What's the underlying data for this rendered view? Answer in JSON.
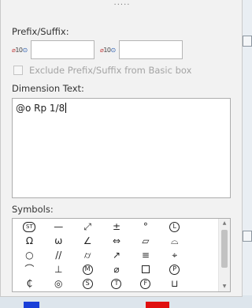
{
  "grip": "·····",
  "prefix_suffix": {
    "label": "Prefix/Suffix:",
    "prefix_icon": "dimension-text-icon",
    "suffix_icon": "dimension-text-icon",
    "prefix_value": "",
    "suffix_value": ""
  },
  "exclude_checkbox": {
    "label": "Exclude Prefix/Suffix from Basic box",
    "checked": false,
    "enabled": false
  },
  "dimension_text": {
    "label": "Dimension Text:",
    "value": "@o Rp 1/8"
  },
  "symbols": {
    "label": "Symbols:",
    "rows": [
      [
        {
          "g": "ST",
          "k": "st",
          "n": "statistical-tolerance"
        },
        {
          "g": "—",
          "n": "straightness"
        },
        {
          "g": "⤢",
          "n": "total-runout"
        },
        {
          "g": "±",
          "n": "plus-minus"
        },
        {
          "g": "°",
          "n": "degree"
        },
        {
          "g": "L",
          "k": "circ",
          "n": "least-material-condition"
        },
        {
          "g": "",
          "n": "blank"
        }
      ],
      [
        {
          "g": "Ω",
          "n": "omega"
        },
        {
          "g": "ω",
          "n": "small-omega"
        },
        {
          "g": "∠",
          "n": "angularity"
        },
        {
          "g": "⇔",
          "n": "between"
        },
        {
          "g": "▱",
          "n": "flatness"
        },
        {
          "g": "⌓",
          "n": "profile-of-surface"
        },
        {
          "g": "",
          "n": "blank"
        }
      ],
      [
        {
          "g": "○",
          "n": "circularity"
        },
        {
          "g": "//",
          "n": "parallelism"
        },
        {
          "g": "⌭",
          "n": "cylindricity"
        },
        {
          "g": "↗",
          "n": "circular-runout"
        },
        {
          "g": "≡",
          "n": "symmetry"
        },
        {
          "g": "⌖",
          "n": "position"
        },
        {
          "g": "",
          "n": "blank"
        }
      ],
      [
        {
          "g": "⌒",
          "n": "profile-of-line"
        },
        {
          "g": "⊥",
          "n": "perpendicularity"
        },
        {
          "g": "M",
          "k": "circ",
          "n": "maximum-material-condition"
        },
        {
          "g": "⌀",
          "n": "diameter"
        },
        {
          "g": "",
          "k": "sq",
          "n": "square"
        },
        {
          "g": "P",
          "k": "circ",
          "n": "projected-tolerance-zone"
        },
        {
          "g": "",
          "n": "blank"
        }
      ],
      [
        {
          "g": "₵",
          "n": "centerline"
        },
        {
          "g": "◎",
          "n": "concentricity"
        },
        {
          "g": "S",
          "k": "circ",
          "n": "regardless-of-feature-size"
        },
        {
          "g": "T",
          "k": "circ",
          "n": "tangent-plane"
        },
        {
          "g": "F",
          "k": "circ",
          "n": "free-state"
        },
        {
          "g": "⊔",
          "n": "counterbore"
        },
        {
          "g": "",
          "n": "blank"
        }
      ]
    ]
  },
  "colors": {
    "panel": "#f2f2f2",
    "blue": "#1a3fd8",
    "red": "#e01010"
  }
}
